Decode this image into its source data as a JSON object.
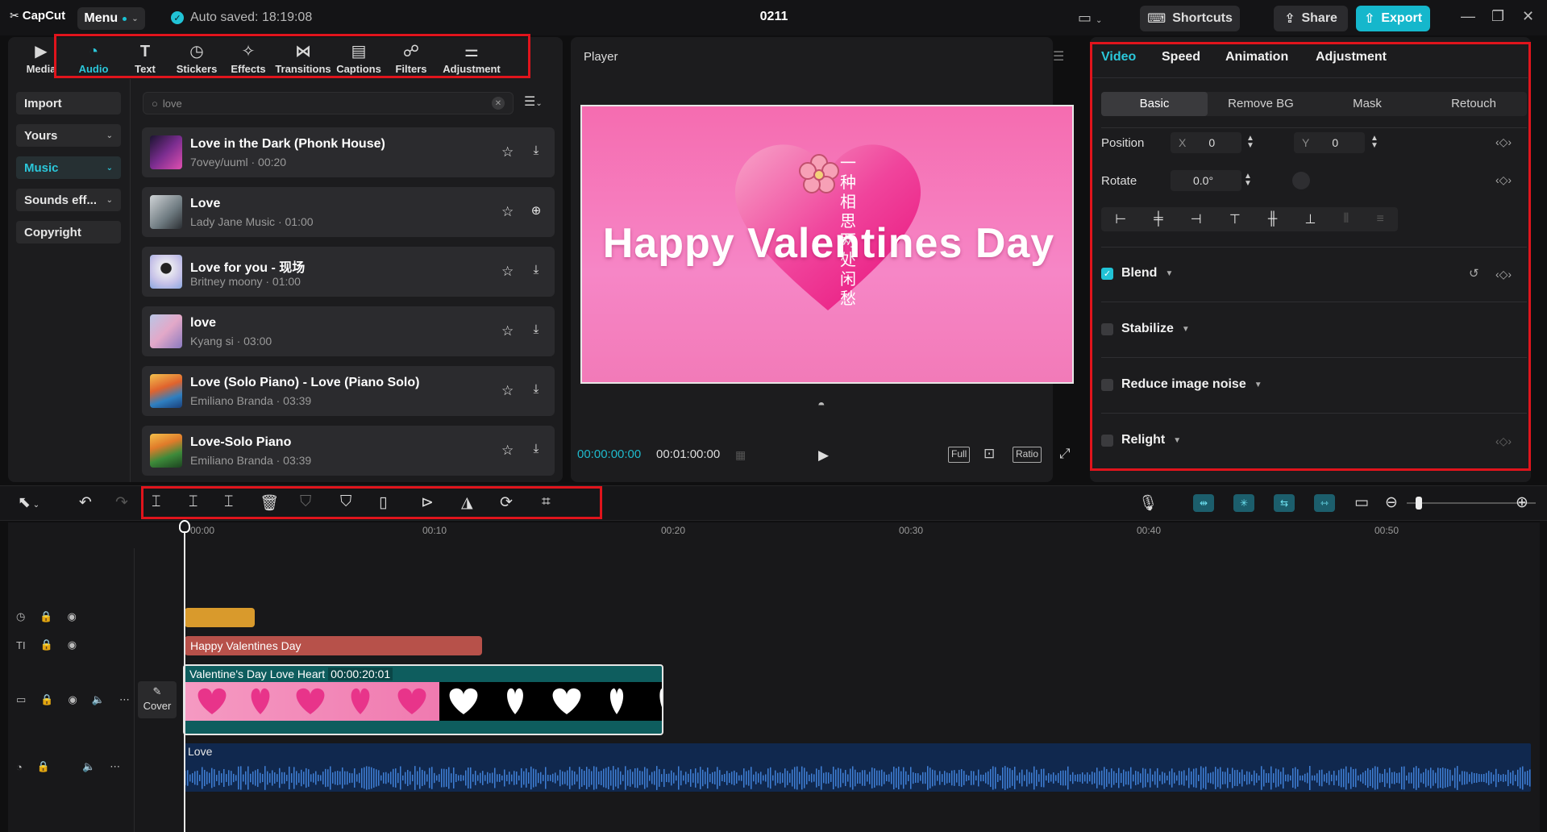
{
  "app": {
    "logo": "CapCut",
    "menu_label": "Menu",
    "autosave": "Auto saved: 18:19:08",
    "project_title": "0211",
    "shortcuts_label": "Shortcuts",
    "share_label": "Share",
    "export_label": "Export"
  },
  "tool_tabs": [
    {
      "label": "Media",
      "icon": "media-icon"
    },
    {
      "label": "Audio",
      "icon": "audio-icon",
      "active": true
    },
    {
      "label": "Text",
      "icon": "text-icon"
    },
    {
      "label": "Stickers",
      "icon": "stickers-icon"
    },
    {
      "label": "Effects",
      "icon": "effects-icon"
    },
    {
      "label": "Transitions",
      "icon": "transitions-icon"
    },
    {
      "label": "Captions",
      "icon": "captions-icon"
    },
    {
      "label": "Filters",
      "icon": "filters-icon"
    },
    {
      "label": "Adjustment",
      "icon": "adjustment-icon"
    }
  ],
  "side_nav": {
    "import": "Import",
    "yours": "Yours",
    "music": "Music",
    "sounds": "Sounds eff...",
    "copyright": "Copyright"
  },
  "search": {
    "value": "love"
  },
  "tracks": [
    {
      "title": "Love in the Dark  (Phonk House)",
      "sub": "7ovey/uuml · 00:20",
      "action": "download"
    },
    {
      "title": "Love",
      "sub": "Lady Jane Music · 01:00",
      "action": "add"
    },
    {
      "title": "Love for you - 现场",
      "sub": "Britney moony · 01:00",
      "action": "download"
    },
    {
      "title": "love",
      "sub": "Kyang si · 03:00",
      "action": "download"
    },
    {
      "title": "Love (Solo Piano) - Love (Piano Solo)",
      "sub": "Emiliano Branda · 03:39",
      "action": "download"
    },
    {
      "title": "Love-Solo Piano",
      "sub": "Emiliano Branda · 03:39",
      "action": "download"
    }
  ],
  "player": {
    "title": "Player",
    "video_text": "Happy Valentines Day",
    "vertical_text": "一种相思两处闲愁",
    "time_current": "00:00:00:00",
    "time_total": "00:01:00:00",
    "full_label": "Full",
    "ratio_label": "Ratio"
  },
  "right_panel": {
    "tabs": [
      "Video",
      "Speed",
      "Animation",
      "Adjustment"
    ],
    "sub_tabs": [
      "Basic",
      "Remove BG",
      "Mask",
      "Retouch"
    ],
    "position_label": "Position",
    "x_label": "X",
    "x_value": "0",
    "y_label": "Y",
    "y_value": "0",
    "rotate_label": "Rotate",
    "rotate_value": "0.0°",
    "blend_label": "Blend",
    "stabilize_label": "Stabilize",
    "noise_label": "Reduce image noise",
    "relight_label": "Relight"
  },
  "timeline": {
    "ruler": [
      "00:00",
      "00:10",
      "00:20",
      "00:30",
      "00:40",
      "00:50"
    ],
    "text_clip": "Happy Valentines Day",
    "video_clip_name": "Valentine's Day Love Heart",
    "video_clip_duration": "00:00:20:01",
    "cover_label": "Cover",
    "audio_clip": "Love"
  },
  "colors": {
    "accent": "#2bc7da",
    "highlight": "#e0141c",
    "text_clip": "#b7514a",
    "sticker_clip": "#d99a2c",
    "audio_clip": "#10284e"
  }
}
